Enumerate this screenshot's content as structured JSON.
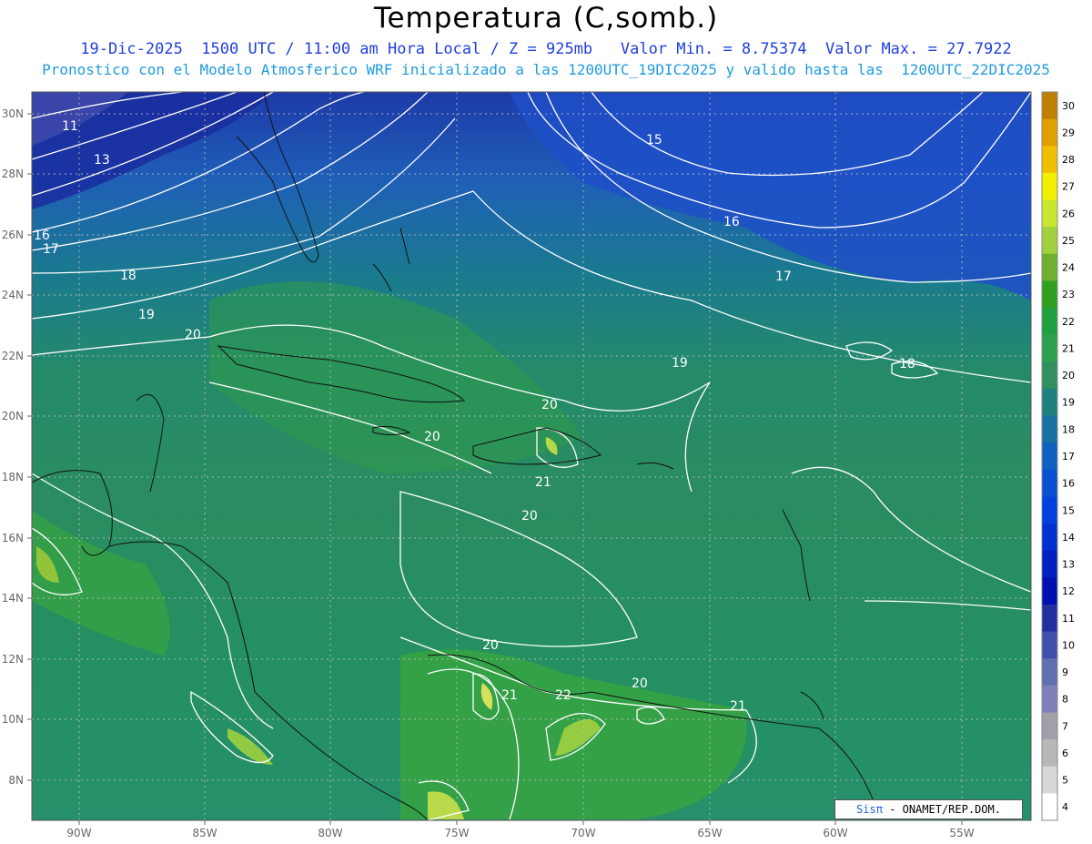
{
  "header": {
    "title": "Temperatura (C,somb.)",
    "line1": "19-Dic-2025  1500 UTC / 11:00 am Hora Local / Z = 925mb   Valor Min. = 8.75374  Valor Max. = 27.7922",
    "line2": "Pronostico con el Modelo Atmosferico WRF inicializado a las 1200UTC_19DIC2025 y valido hasta las  1200UTC_22DIC2025"
  },
  "map": {
    "lat_labels": [
      "30N",
      "28N",
      "26N",
      "24N",
      "22N",
      "20N",
      "18N",
      "16N",
      "14N",
      "12N",
      "10N",
      "8N"
    ],
    "lon_labels": [
      "90W",
      "85W",
      "80W",
      "75W",
      "70W",
      "65W",
      "60W",
      "55W"
    ],
    "contour_labels": [
      "11",
      "13",
      "15",
      "16",
      "16",
      "17",
      "17",
      "18",
      "18",
      "19",
      "19",
      "20",
      "20",
      "20",
      "20",
      "20",
      "20",
      "21",
      "21",
      "21",
      "22"
    ]
  },
  "colorbar": {
    "ticks": [
      "30",
      "29",
      "28",
      "27",
      "26",
      "25",
      "24",
      "23",
      "22",
      "21",
      "20",
      "19",
      "18",
      "17",
      "16",
      "15",
      "14",
      "13",
      "12",
      "11",
      "10",
      "9",
      "8",
      "7",
      "6",
      "5",
      "4"
    ],
    "colors": [
      "#c08000",
      "#e0a000",
      "#f0c000",
      "#f0f000",
      "#c8e830",
      "#a0d040",
      "#70b030",
      "#30a020",
      "#20a040",
      "#30a050",
      "#309060",
      "#208080",
      "#1870a0",
      "#1060c0",
      "#0850d0",
      "#0040e0",
      "#0030d0",
      "#0020c0",
      "#0010b0",
      "#2030a0",
      "#4050a8",
      "#6070b0",
      "#8080b8",
      "#a0a0a8",
      "#b8b8b8",
      "#d8d8d8",
      "#ffffff"
    ]
  },
  "credit": {
    "brand": "Sisπ",
    "text": " - ONAMET/REP.DOM."
  }
}
